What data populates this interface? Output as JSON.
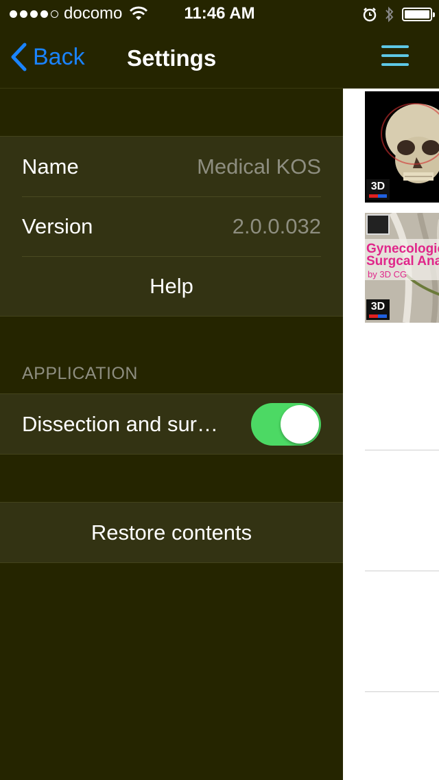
{
  "status_bar": {
    "carrier": "docomo",
    "time": "11:46 AM",
    "signal_bars": 4,
    "battery_level": 1.0
  },
  "nav": {
    "back_label": "Back",
    "title": "Settings",
    "menu_icon": "hamburger-icon"
  },
  "info_group": {
    "name_label": "Name",
    "name_value": "Medical KOS",
    "version_label": "Version",
    "version_value": "2.0.0.032",
    "help_label": "Help"
  },
  "application_section": {
    "header": "APPLICATION",
    "toggle_label": "Dissection and sur…",
    "toggle_on": true
  },
  "restore": {
    "label": "Restore contents"
  },
  "right_panel": {
    "thumb1_badge": "3D",
    "thumb2_title_line1": "Gynecologic",
    "thumb2_title_line2": "Surgcal Ana",
    "thumb2_subtitle": "by 3D CG",
    "thumb2_badge": "3D"
  },
  "colors": {
    "background": "#252500",
    "cell_background": "#333313",
    "tint_blue": "#1a84ff",
    "toggle_green": "#4cd964",
    "menu_icon": "#5ec8e6"
  }
}
